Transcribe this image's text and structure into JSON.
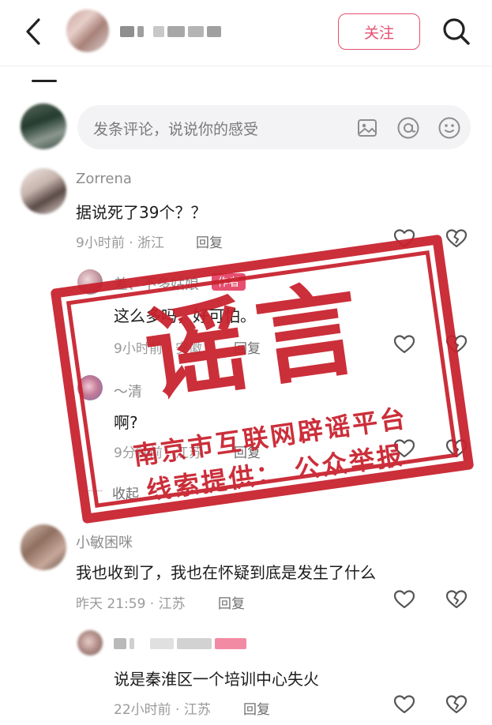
{
  "header": {
    "follow_label": "关注"
  },
  "compose": {
    "placeholder": "发条评论，说说你的感受"
  },
  "comments": [
    {
      "name": "Zorrena",
      "text": "据说死了39个？？",
      "time": "9小时前",
      "location": "浙江",
      "reply_label": "回复",
      "replies": [
        {
          "name": "差、不多姑娘",
          "badge": "作者",
          "text": "这么多吗，好可怕。",
          "time": "9小时前",
          "location": "安徽",
          "reply_label": "回复"
        },
        {
          "name": "～清",
          "text": "啊?",
          "time": "9分钟前",
          "location": "江苏",
          "reply_label": "回复"
        }
      ],
      "collapse_label": "收起"
    },
    {
      "name": "小敏困咪",
      "text": "我也收到了，我也在怀疑到底是发生了什么",
      "time": "昨天 21:59",
      "location": "江苏",
      "reply_label": "回复",
      "replies": [
        {
          "text": "说是秦淮区一个培训中心失火",
          "time": "22小时前",
          "location": "江苏",
          "reply_label": "回复"
        }
      ]
    }
  ],
  "stamp": {
    "title": "谣言",
    "line1": "南京市互联网辟谣平台",
    "line2": "线索提供： 公众举报",
    "color": "#c8202c"
  },
  "colors": {
    "accent": "#e64f6f",
    "text_secondary": "#9a9a9a"
  },
  "icons": {
    "back": "chevron-left-icon",
    "search": "search-icon",
    "image": "image-icon",
    "mention": "at-icon",
    "emoji": "smiley-icon",
    "like": "heart-icon",
    "dislike": "broken-heart-icon"
  }
}
